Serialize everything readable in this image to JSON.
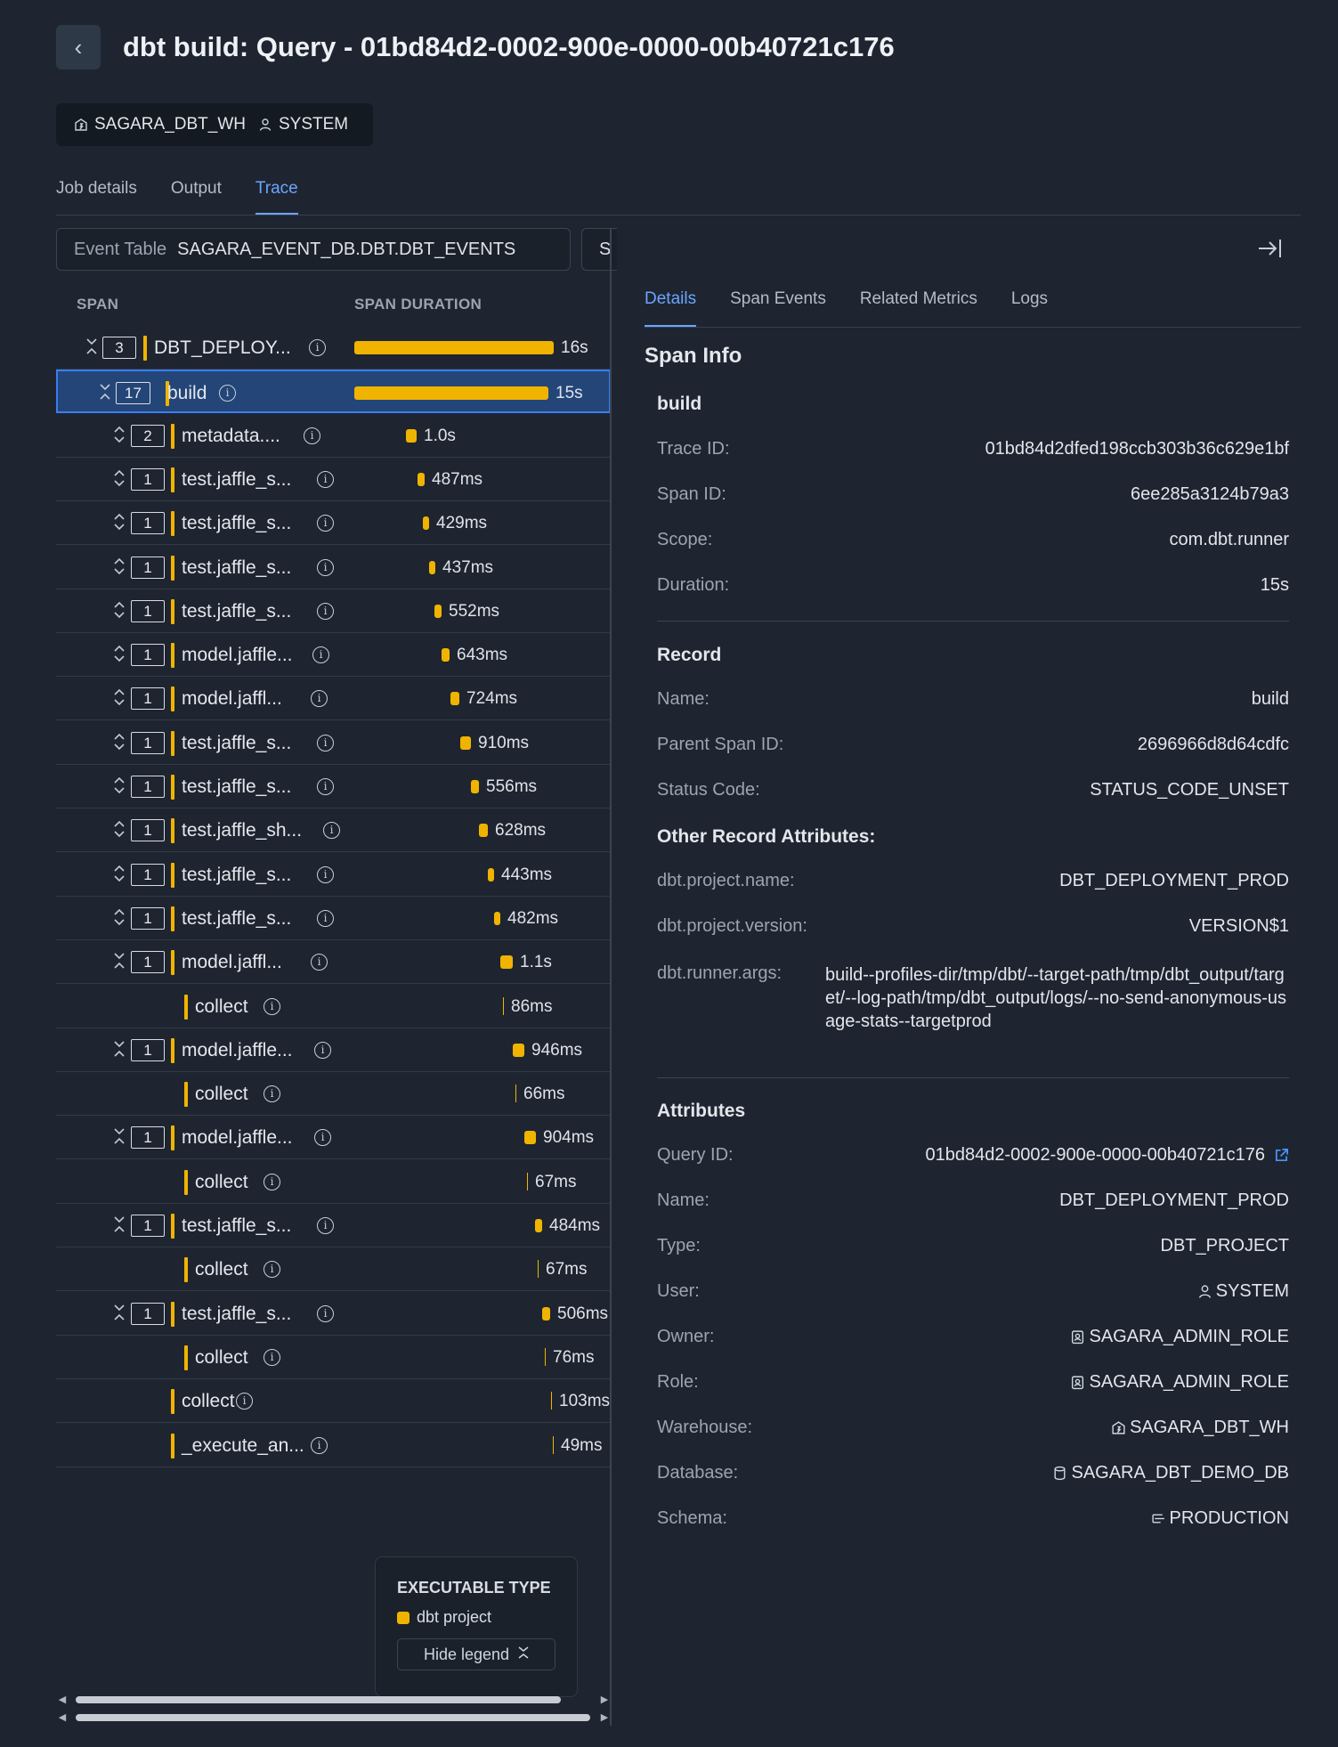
{
  "header": {
    "back_icon": "chevron-left-icon",
    "title": "dbt build: Query - 01bd84d2-0002-900e-0000-00b40721c176"
  },
  "chips": {
    "warehouse": "SAGARA_DBT_WH",
    "user": "SYSTEM"
  },
  "tabs": [
    {
      "label": "Job details",
      "active": false
    },
    {
      "label": "Output",
      "active": false
    },
    {
      "label": "Trace",
      "active": true
    }
  ],
  "trace": {
    "event_table_label": "Event Table",
    "event_table_value": "SAGARA_EVENT_DB.DBT.DBT_EVENTS",
    "second_filter_value": "S",
    "columns": {
      "span": "SPAN",
      "duration": "SPAN DURATION"
    },
    "rows": [
      {
        "toggle": "collapse",
        "count": "3",
        "name": "DBT_DEPLOY...",
        "duration": "16s",
        "level": 0
      },
      {
        "toggle": "collapse",
        "count": "17",
        "name": "build",
        "duration": "15s",
        "level": 1,
        "selected": true
      },
      {
        "toggle": "expand",
        "count": "2",
        "name": "metadata....",
        "duration": "1.0s",
        "level": 2
      },
      {
        "toggle": "expand",
        "count": "1",
        "name": "test.jaffle_s...",
        "duration": "487ms",
        "level": 2
      },
      {
        "toggle": "expand",
        "count": "1",
        "name": "test.jaffle_s...",
        "duration": "429ms",
        "level": 2
      },
      {
        "toggle": "expand",
        "count": "1",
        "name": "test.jaffle_s...",
        "duration": "437ms",
        "level": 2
      },
      {
        "toggle": "expand",
        "count": "1",
        "name": "test.jaffle_s...",
        "duration": "552ms",
        "level": 2
      },
      {
        "toggle": "expand",
        "count": "1",
        "name": "model.jaffle...",
        "duration": "643ms",
        "level": 2
      },
      {
        "toggle": "expand",
        "count": "1",
        "name": "model.jaffl...",
        "duration": "724ms",
        "level": 2
      },
      {
        "toggle": "expand",
        "count": "1",
        "name": "test.jaffle_s...",
        "duration": "910ms",
        "level": 2
      },
      {
        "toggle": "expand",
        "count": "1",
        "name": "test.jaffle_s...",
        "duration": "556ms",
        "level": 2
      },
      {
        "toggle": "expand",
        "count": "1",
        "name": "test.jaffle_sh...",
        "duration": "628ms",
        "level": 2
      },
      {
        "toggle": "expand",
        "count": "1",
        "name": "test.jaffle_s...",
        "duration": "443ms",
        "level": 2
      },
      {
        "toggle": "expand",
        "count": "1",
        "name": "test.jaffle_s...",
        "duration": "482ms",
        "level": 2
      },
      {
        "toggle": "collapse",
        "count": "1",
        "name": "model.jaffl...",
        "duration": "1.1s",
        "level": 2
      },
      {
        "toggle": "",
        "count": "",
        "name": "collect",
        "duration": "86ms",
        "level": 3
      },
      {
        "toggle": "collapse",
        "count": "1",
        "name": "model.jaffle...",
        "duration": "946ms",
        "level": 2
      },
      {
        "toggle": "",
        "count": "",
        "name": "collect",
        "duration": "66ms",
        "level": 3
      },
      {
        "toggle": "collapse",
        "count": "1",
        "name": "model.jaffle...",
        "duration": "904ms",
        "level": 2
      },
      {
        "toggle": "",
        "count": "",
        "name": "collect",
        "duration": "67ms",
        "level": 3
      },
      {
        "toggle": "collapse",
        "count": "1",
        "name": "test.jaffle_s...",
        "duration": "484ms",
        "level": 2
      },
      {
        "toggle": "",
        "count": "",
        "name": "collect",
        "duration": "67ms",
        "level": 3
      },
      {
        "toggle": "collapse",
        "count": "1",
        "name": "test.jaffle_s...",
        "duration": "506ms",
        "level": 2
      },
      {
        "toggle": "",
        "count": "",
        "name": "collect",
        "duration": "76ms",
        "level": 3
      },
      {
        "toggle": "",
        "count": "",
        "name": "collect",
        "duration": "103ms",
        "level": 2
      },
      {
        "toggle": "",
        "count": "",
        "name": "_execute_an...",
        "duration": "49ms",
        "level": 2
      }
    ],
    "legend": {
      "title": "EXECUTABLE TYPE",
      "item": "dbt project",
      "item_color": "#f0b400",
      "hide_label": "Hide legend"
    }
  },
  "details": {
    "tabs": [
      {
        "label": "Details",
        "active": true
      },
      {
        "label": "Span Events",
        "active": false
      },
      {
        "label": "Related Metrics",
        "active": false
      },
      {
        "label": "Logs",
        "active": false
      }
    ],
    "section_title": "Span Info",
    "span_name": "build",
    "span_info": [
      {
        "k": "Trace ID:",
        "v": "01bd84d2dfed198ccb303b36c629e1bf"
      },
      {
        "k": "Span ID:",
        "v": "6ee285a3124b79a3"
      },
      {
        "k": "Scope:",
        "v": "com.dbt.runner"
      },
      {
        "k": "Duration:",
        "v": "15s"
      }
    ],
    "record_title": "Record",
    "record": [
      {
        "k": "Name:",
        "v": "build"
      },
      {
        "k": "Parent Span ID:",
        "v": "2696966d8d64cdfc"
      },
      {
        "k": "Status Code:",
        "v": "STATUS_CODE_UNSET"
      }
    ],
    "other_title": "Other Record Attributes:",
    "other": [
      {
        "k": "dbt.project.name:",
        "v": "DBT_DEPLOYMENT_PROD"
      },
      {
        "k": "dbt.project.version:",
        "v": "VERSION$1"
      }
    ],
    "args_key": "dbt.runner.args:",
    "args_value": "build--profiles-dir/tmp/dbt/--target-path/tmp/dbt_output/target/--log-path/tmp/dbt_output/logs/--no-send-anonymous-usage-stats--targetprod",
    "attributes_title": "Attributes",
    "attributes": [
      {
        "k": "Query ID:",
        "v": "01bd84d2-0002-900e-0000-00b40721c176",
        "icon": "external-link-icon"
      },
      {
        "k": "Name:",
        "v": "DBT_DEPLOYMENT_PROD"
      },
      {
        "k": "Type:",
        "v": "DBT_PROJECT"
      },
      {
        "k": "User:",
        "v": "SYSTEM",
        "icon": "user-icon"
      },
      {
        "k": "Owner:",
        "v": "SAGARA_ADMIN_ROLE",
        "icon": "role-icon"
      },
      {
        "k": "Role:",
        "v": "SAGARA_ADMIN_ROLE",
        "icon": "role-icon"
      },
      {
        "k": "Warehouse:",
        "v": "SAGARA_DBT_WH",
        "icon": "warehouse-icon"
      },
      {
        "k": "Database:",
        "v": "SAGARA_DBT_DEMO_DB",
        "icon": "database-icon"
      },
      {
        "k": "Schema:",
        "v": "PRODUCTION",
        "icon": "schema-icon"
      }
    ]
  },
  "colors": {
    "background": "#1e2530",
    "accent": "#6aa5ff",
    "bar": "#f0b400",
    "selected_row": "#244577"
  }
}
